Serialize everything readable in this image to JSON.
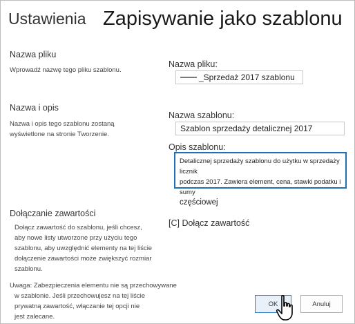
{
  "header": {
    "breadcrumb": "Ustawienia",
    "page_title": "Zapisywanie jako szablonu"
  },
  "sections": {
    "file_name": {
      "title": "Nazwa pliku",
      "description": "Wprowadź nazwę tego pliku szablonu."
    },
    "name_desc": {
      "title": "Nazwa i opis",
      "description_lines": [
        "Nazwa i opis tego szablonu zostaną",
        "wyświetlone na stronie Tworzenie."
      ]
    },
    "include_content": {
      "title": "Dołączanie zawartości",
      "description_lines": [
        "Dołącz zawartość do szablonu, jeśli chcesz,",
        "aby nowe listy utworzone przy użyciu tego",
        "szablonu, aby uwzględnić elementy na tej liście",
        "dołączenie zawartości może zwiększyć rozmiar",
        "szablonu."
      ],
      "warning_lines": [
        "Uwaga: Zabezpieczenia elementu nie są przechowywane",
        "w szablonie. Jeśli przechowujesz na tej liście",
        "prywatną zawartość, włączanie tej opcji nie",
        "jest zalecane."
      ]
    }
  },
  "form": {
    "file_name_label": "Nazwa pliku:",
    "file_name_value": "_Sprzedaż 2017 szablonu",
    "template_name_label": "Nazwa szablonu:",
    "template_name_value": "Szablon sprzedaży detalicznej 2017",
    "template_desc_label": "Opis szablonu:",
    "template_desc_lines": [
      "Detalicznej sprzedaży szablonu do użytku w sprzedaży licznik",
      "podczas 2017. Zawiera element, cena, stawki podatku i sumy",
      "częściowej"
    ],
    "include_checkbox_label": "[C] Dołącz zawartość"
  },
  "buttons": {
    "ok": "OK",
    "cancel": "Anuluj"
  }
}
